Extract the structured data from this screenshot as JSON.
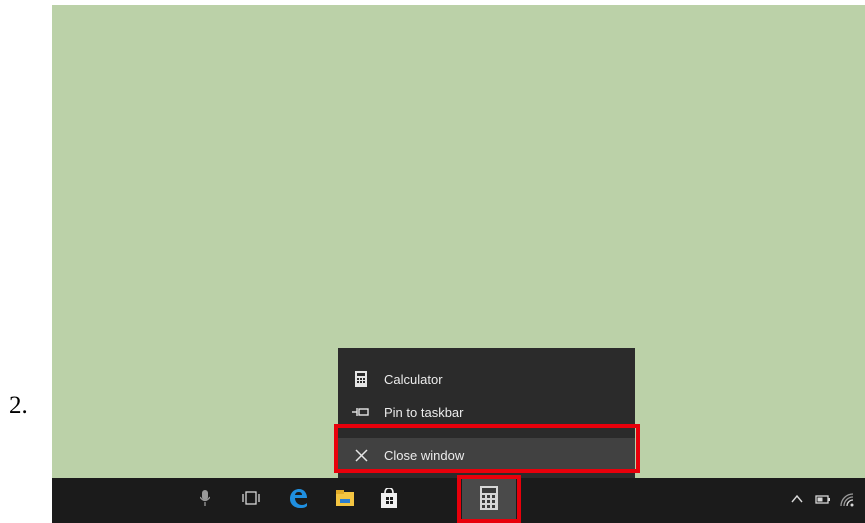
{
  "step": {
    "number": "2."
  },
  "jumplist": {
    "items": [
      {
        "label": "Calculator",
        "icon": "calculator-icon"
      },
      {
        "label": "Pin to taskbar",
        "icon": "pin-icon"
      },
      {
        "label": "Close window",
        "icon": "close-icon"
      }
    ]
  },
  "taskbar": {
    "apps": [
      "microphone-icon",
      "task-view-icon",
      "edge-icon",
      "file-explorer-icon",
      "store-icon",
      "calculator-icon"
    ],
    "active_app": "calculator-icon",
    "tray": [
      "chevron-up-icon",
      "battery-icon",
      "wifi-icon"
    ]
  },
  "colors": {
    "desktop": "#bbd1a8",
    "taskbar": "#1b1b1b",
    "menu": "#2b2b2b",
    "highlight": "#e8000b",
    "edge_blue": "#1f8fe0",
    "folder_yellow": "#f4c542"
  }
}
